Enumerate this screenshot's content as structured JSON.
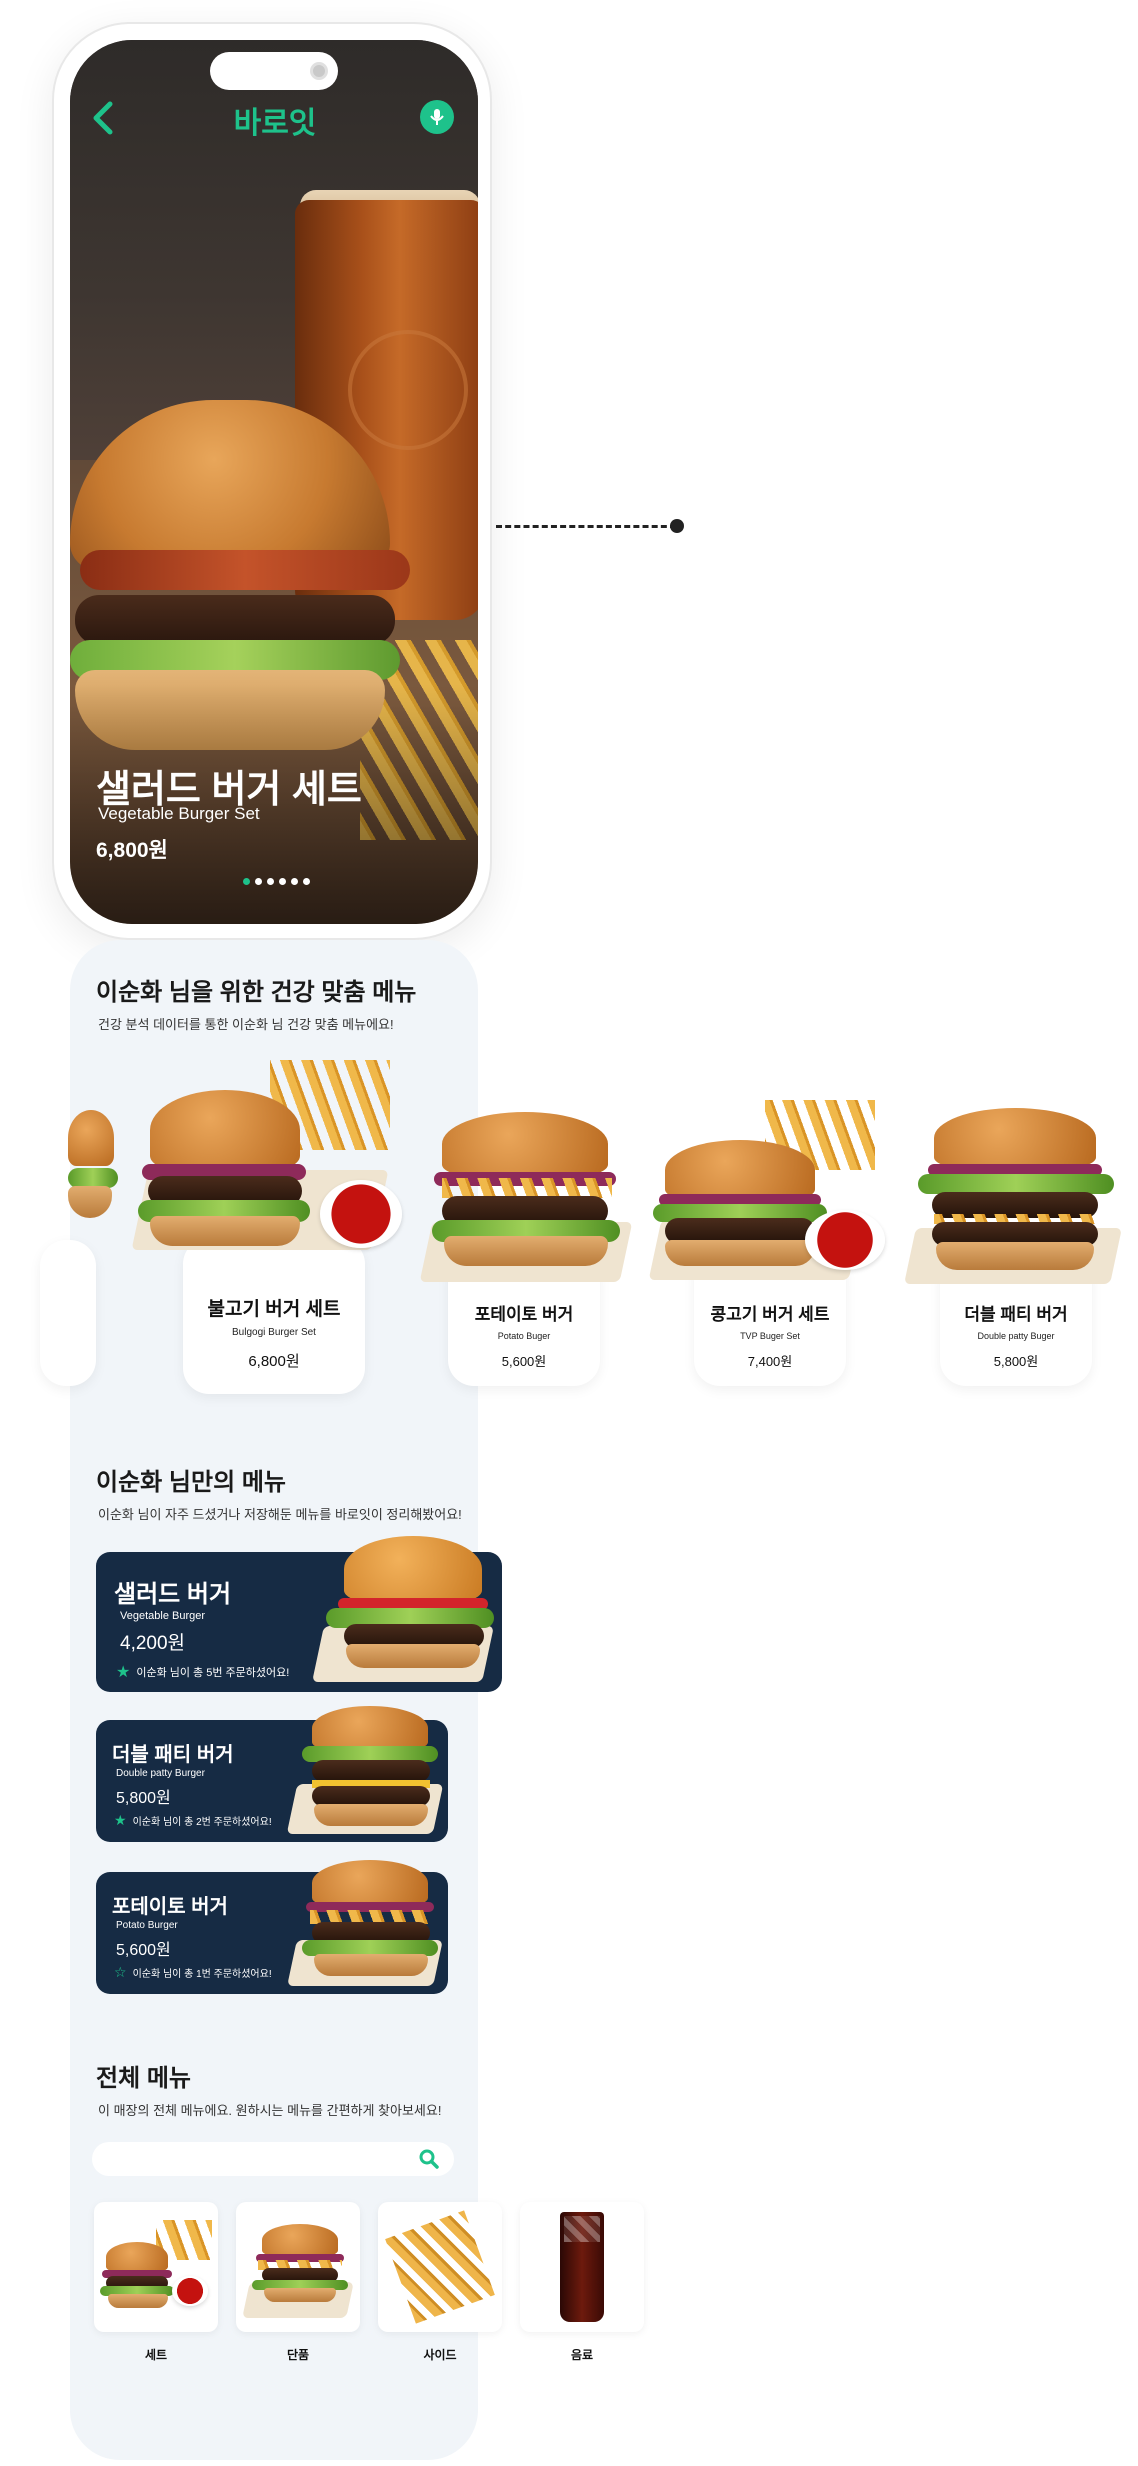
{
  "header": {
    "title": "바로잇"
  },
  "hero": {
    "name": "샐러드 버거 세트",
    "name_en": "Vegetable Burger Set",
    "price": "6,800원",
    "slide_count": 6,
    "active_slide": 1
  },
  "recommend": {
    "title": "이순화 님을 위한 건강 맞춤 메뉴",
    "subtitle": "건강 분석 데이터를 통한 이순화 님 건강 맞춤 메뉴에요!",
    "items": [
      {
        "name": "불고기 버거 세트",
        "name_en": "Bulgogi Burger Set",
        "price": "6,800원"
      },
      {
        "name": "포테이토 버거",
        "name_en": "Potato Buger",
        "price": "5,600원"
      },
      {
        "name": "콩고기 버거 세트",
        "name_en": "TVP Buger Set",
        "price": "7,400원"
      },
      {
        "name": "더블 패티 버거",
        "name_en": "Double patty Buger",
        "price": "5,800원"
      }
    ]
  },
  "my_menu": {
    "title": "이순화 님만의 메뉴",
    "subtitle": "이순화 님이 자주 드셨거나 저장해둔 메뉴를 바로잇이 정리해봤어요!",
    "items": [
      {
        "name": "샐러드 버거",
        "name_en": "Vegetable Burger",
        "price": "4,200원",
        "note": "이순화 님이 총 5번 주문하셨어요!",
        "starred": true
      },
      {
        "name": "더블 패티 버거",
        "name_en": "Double patty Burger",
        "price": "5,800원",
        "note": "이순화 님이 총 2번 주문하셨어요!",
        "starred": true
      },
      {
        "name": "포테이토 버거",
        "name_en": "Potato Burger",
        "price": "5,600원",
        "note": "이순화 님이 총 1번 주문하셨어요!",
        "starred": false
      }
    ]
  },
  "all_menu": {
    "title": "전체 메뉴",
    "subtitle": "이 매장의 전체 메뉴에요. 원하시는 메뉴를 간편하게 찾아보세요!",
    "search_placeholder": "",
    "categories": [
      "세트",
      "단품",
      "사이드",
      "음료"
    ]
  },
  "colors": {
    "accent": "#1ec28b",
    "card_dark": "#162b44",
    "panel_bg": "#f1f5f9"
  },
  "icons": {
    "back": "chevron-left-icon",
    "mic": "microphone-icon",
    "search": "search-icon",
    "star": "star-icon"
  }
}
